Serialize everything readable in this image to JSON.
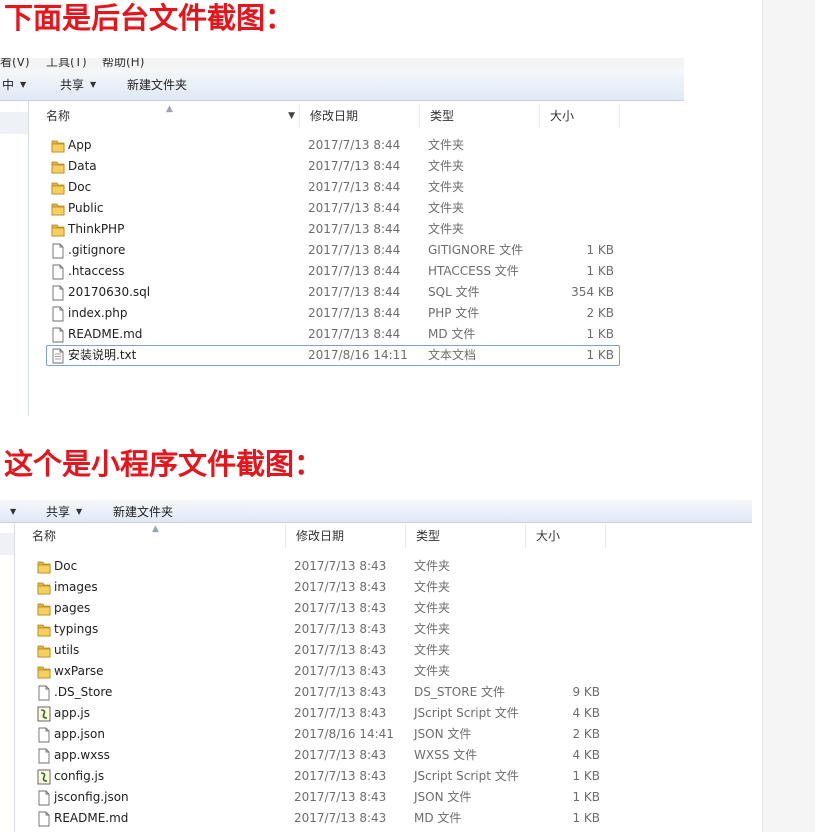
{
  "captions": {
    "backend": "下面是后台文件截图：",
    "miniprogram": "这个是小程序文件截图："
  },
  "colors": {
    "caption": "#e8141b",
    "toolbar_top": "#f5f8fc",
    "toolbar_bottom": "#dfe9f5",
    "selection_border": "#7da2ce",
    "folder": "#e7b43a"
  },
  "backend_panel": {
    "menubar": [
      "看(V)",
      "工具(T)",
      "帮助(H)"
    ],
    "toolbar": [
      {
        "label": "中",
        "dropdown": true
      },
      {
        "label": "共享",
        "dropdown": true
      },
      {
        "label": "新建文件夹",
        "dropdown": false
      }
    ],
    "columns": {
      "name": "名称",
      "modified": "修改日期",
      "type": "类型",
      "size": "大小"
    },
    "files": [
      {
        "name": "App",
        "modified": "2017/7/13 8:44",
        "type": "文件夹",
        "size": "",
        "icon": "folder-icon"
      },
      {
        "name": "Data",
        "modified": "2017/7/13 8:44",
        "type": "文件夹",
        "size": "",
        "icon": "folder-icon"
      },
      {
        "name": "Doc",
        "modified": "2017/7/13 8:44",
        "type": "文件夹",
        "size": "",
        "icon": "folder-icon"
      },
      {
        "name": "Public",
        "modified": "2017/7/13 8:44",
        "type": "文件夹",
        "size": "",
        "icon": "folder-icon"
      },
      {
        "name": "ThinkPHP",
        "modified": "2017/7/13 8:44",
        "type": "文件夹",
        "size": "",
        "icon": "folder-icon"
      },
      {
        "name": ".gitignore",
        "modified": "2017/7/13 8:44",
        "type": "GITIGNORE 文件",
        "size": "1 KB",
        "icon": "file-icon"
      },
      {
        "name": ".htaccess",
        "modified": "2017/7/13 8:44",
        "type": "HTACCESS 文件",
        "size": "1 KB",
        "icon": "file-icon"
      },
      {
        "name": "20170630.sql",
        "modified": "2017/7/13 8:44",
        "type": "SQL 文件",
        "size": "354 KB",
        "icon": "file-icon"
      },
      {
        "name": "index.php",
        "modified": "2017/7/13 8:44",
        "type": "PHP 文件",
        "size": "2 KB",
        "icon": "file-icon"
      },
      {
        "name": "README.md",
        "modified": "2017/7/13 8:44",
        "type": "MD 文件",
        "size": "1 KB",
        "icon": "file-icon"
      },
      {
        "name": "安装说明.txt",
        "modified": "2017/8/16 14:11",
        "type": "文本文档",
        "size": "1 KB",
        "icon": "text-file-icon",
        "selected": true
      }
    ]
  },
  "miniprogram_panel": {
    "toolbar": [
      {
        "label": "",
        "dropdown": true
      },
      {
        "label": "共享",
        "dropdown": true
      },
      {
        "label": "新建文件夹",
        "dropdown": false
      }
    ],
    "columns": {
      "name": "名称",
      "modified": "修改日期",
      "type": "类型",
      "size": "大小"
    },
    "files": [
      {
        "name": "Doc",
        "modified": "2017/7/13 8:43",
        "type": "文件夹",
        "size": "",
        "icon": "folder-icon"
      },
      {
        "name": "images",
        "modified": "2017/7/13 8:43",
        "type": "文件夹",
        "size": "",
        "icon": "folder-icon"
      },
      {
        "name": "pages",
        "modified": "2017/7/13 8:43",
        "type": "文件夹",
        "size": "",
        "icon": "folder-icon"
      },
      {
        "name": "typings",
        "modified": "2017/7/13 8:43",
        "type": "文件夹",
        "size": "",
        "icon": "folder-icon"
      },
      {
        "name": "utils",
        "modified": "2017/7/13 8:43",
        "type": "文件夹",
        "size": "",
        "icon": "folder-icon"
      },
      {
        "name": "wxParse",
        "modified": "2017/7/13 8:43",
        "type": "文件夹",
        "size": "",
        "icon": "folder-icon"
      },
      {
        "name": ".DS_Store",
        "modified": "2017/7/13 8:43",
        "type": "DS_STORE 文件",
        "size": "9 KB",
        "icon": "file-icon"
      },
      {
        "name": "app.js",
        "modified": "2017/7/13 8:43",
        "type": "JScript Script 文件",
        "size": "4 KB",
        "icon": "script-file-icon"
      },
      {
        "name": "app.json",
        "modified": "2017/8/16 14:41",
        "type": "JSON 文件",
        "size": "2 KB",
        "icon": "file-icon"
      },
      {
        "name": "app.wxss",
        "modified": "2017/7/13 8:43",
        "type": "WXSS 文件",
        "size": "4 KB",
        "icon": "file-icon"
      },
      {
        "name": "config.js",
        "modified": "2017/7/13 8:43",
        "type": "JScript Script 文件",
        "size": "1 KB",
        "icon": "script-file-icon"
      },
      {
        "name": "jsconfig.json",
        "modified": "2017/7/13 8:43",
        "type": "JSON 文件",
        "size": "1 KB",
        "icon": "file-icon"
      },
      {
        "name": "README.md",
        "modified": "2017/7/13 8:43",
        "type": "MD 文件",
        "size": "1 KB",
        "icon": "file-icon"
      }
    ]
  }
}
